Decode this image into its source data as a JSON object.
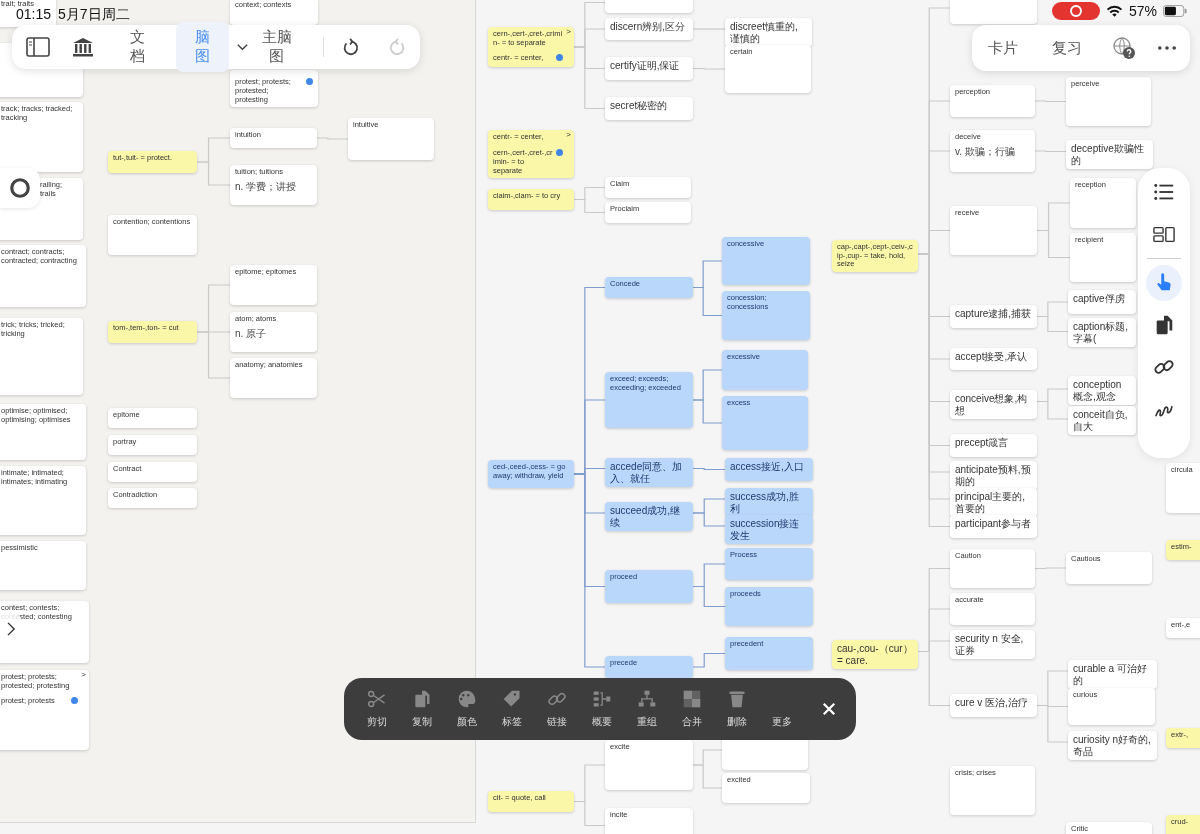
{
  "status_bar": {
    "time": "01:15",
    "date": "5月7日周二",
    "recording": true,
    "battery": "57%"
  },
  "toolbar": {
    "tabs": [
      {
        "label": "文档",
        "selected": false
      },
      {
        "label": "脑图",
        "selected": true
      }
    ],
    "map_selector": "主脑图",
    "undo": {
      "disabled": false
    },
    "redo": {
      "disabled": true
    }
  },
  "toolbar_right": {
    "tabs": [
      {
        "label": "卡片"
      },
      {
        "label": "复习"
      }
    ]
  },
  "map": {
    "nodes": [
      {
        "kind": "plain",
        "title": "trait; traits"
      },
      {
        "kind": "plain"
      },
      {
        "kind": "plain",
        "title": "track; tracks; tracked; tracking"
      },
      {
        "kind": "plain",
        "title": "railing; trails"
      },
      {
        "kind": "plain",
        "title": "contract; contracts; contracted; contracting"
      },
      {
        "kind": "plain",
        "title": "trick; tricks; tricked; tricking"
      },
      {
        "kind": "plain",
        "title": "optimise; optimised; optimising; optimises"
      },
      {
        "kind": "plain",
        "title": "intimate; intimated; intimates; intimating"
      },
      {
        "kind": "plain",
        "title": "pessimistic"
      },
      {
        "kind": "plain",
        "title": "contest; contests; contested; contesting"
      },
      {
        "kind": "plain",
        "title": "protest; protests; protested; protesting",
        "badge": ">",
        "footer": "protest; protests"
      },
      {
        "kind": "plain",
        "title": "context; contexts"
      },
      {
        "kind": "plain",
        "footer": "protest; protests; protested; protesting"
      },
      {
        "kind": "topic",
        "title": "tut-,tuit- = protect.",
        "children": [
          {
            "kind": "plain",
            "title": "intuition",
            "children": [
              {
                "kind": "plain",
                "title": "intuitive"
              }
            ]
          },
          {
            "kind": "plain",
            "title": "tuition; tuitions",
            "note": "n. 学费；讲授"
          }
        ]
      },
      {
        "kind": "plain",
        "title": "contention; contentions"
      },
      {
        "kind": "topic",
        "title": "tom-,tem-,ton- = cut",
        "children": [
          {
            "kind": "plain",
            "title": "epitome; epitomes"
          },
          {
            "kind": "plain",
            "title": "atom; atoms",
            "note": "n. 原子"
          },
          {
            "kind": "plain",
            "title": "anatomy; anatomies"
          }
        ]
      },
      {
        "kind": "plain",
        "title": "epitome"
      },
      {
        "kind": "plain",
        "title": "portray"
      },
      {
        "kind": "plain",
        "title": "Contract"
      },
      {
        "kind": "plain",
        "title": "Contradiction"
      },
      {
        "kind": "topic",
        "title": "cern-,cert-,cret-,crimin- = to separate",
        "badge": ">",
        "footer": "centr- = center,",
        "children": [
          {
            "kind": "plain"
          },
          {
            "kind": "plain",
            "title": "discern辨别,区分",
            "children": [
              {
                "kind": "plain",
                "title": "discreet慎重的,谨慎的"
              }
            ]
          },
          {
            "kind": "plain",
            "title": "certify证明,保证",
            "children": [
              {
                "kind": "plain",
                "title": "certain"
              }
            ]
          },
          {
            "kind": "plain",
            "title": "secret秘密的"
          }
        ]
      },
      {
        "kind": "topic",
        "title": "centr- = center,",
        "badge": ">",
        "footer": "cern-,cert-,cret-,crimin- = to separate"
      },
      {
        "kind": "topic",
        "title": "claim-,clam- = to cry",
        "children": [
          {
            "kind": "plain",
            "title": "Claim"
          },
          {
            "kind": "plain",
            "title": "Proclaim"
          }
        ]
      },
      {
        "kind": "blue",
        "title": "ced-,ceed-,cess- = go away; withdraw, yield",
        "children": [
          {
            "kind": "blue",
            "title": "Concede",
            "children": [
              {
                "kind": "blue",
                "title": "concessive"
              },
              {
                "kind": "blue",
                "title": "concession; concessions"
              }
            ]
          },
          {
            "kind": "blue",
            "title": "exceed; exceeds; exceeding; exceeded",
            "children": [
              {
                "kind": "blue",
                "title": "excessive"
              },
              {
                "kind": "blue",
                "title": "excess"
              }
            ]
          },
          {
            "kind": "blue",
            "title": "accede同意、加入、就任",
            "children": [
              {
                "kind": "blue",
                "title": "access接近,入口"
              }
            ]
          },
          {
            "kind": "blue",
            "title": "succeed成功,继续",
            "children": [
              {
                "kind": "blue",
                "title": "success成功,胜利"
              },
              {
                "kind": "blue",
                "title": "succession接连发生"
              }
            ]
          },
          {
            "kind": "blue",
            "title": "proceed",
            "children": [
              {
                "kind": "blue",
                "title": "Process"
              },
              {
                "kind": "blue",
                "title": "proceeds"
              }
            ]
          },
          {
            "kind": "blue",
            "title": "precede",
            "children": [
              {
                "kind": "blue",
                "title": "precedent"
              }
            ]
          }
        ]
      },
      {
        "kind": "topic",
        "title": "cit- = quote, call",
        "children": [
          {
            "kind": "plain",
            "title": "excite",
            "children": [
              {
                "kind": "plain"
              },
              {
                "kind": "plain",
                "title": "excited"
              }
            ]
          },
          {
            "kind": "plain",
            "title": "incite"
          }
        ]
      },
      {
        "kind": "topic",
        "title": "cap-,capt-,cept-,ceiv-,cip-,cup- = take, hold, seize",
        "children": [
          {
            "kind": "plain"
          },
          {
            "kind": "plain",
            "title": "perception",
            "children": [
              {
                "kind": "plain",
                "title": "perceive"
              }
            ]
          },
          {
            "kind": "plain",
            "title": "deceive",
            "note": "v. 欺骗；行骗",
            "children": [
              {
                "kind": "plain",
                "title": "deceptive欺骗性的"
              }
            ]
          },
          {
            "kind": "plain",
            "title": "receive",
            "children": [
              {
                "kind": "plain",
                "title": "reception"
              },
              {
                "kind": "plain",
                "title": "recipient"
              }
            ]
          },
          {
            "kind": "plain",
            "title": "capture逮捕,捕获",
            "children": [
              {
                "kind": "plain",
                "title": "captive俘虏"
              },
              {
                "kind": "plain",
                "title": "caption标题,字幕("
              }
            ]
          },
          {
            "kind": "plain",
            "title": "accept接受,承认"
          },
          {
            "kind": "plain",
            "title": "conceive想象,构想",
            "children": [
              {
                "kind": "plain",
                "title": "conception概念,观念"
              },
              {
                "kind": "plain",
                "title": "conceit自负,自大"
              }
            ]
          },
          {
            "kind": "plain",
            "title": "precept箴言"
          },
          {
            "kind": "plain",
            "title": "anticipate预料,预期的"
          },
          {
            "kind": "plain",
            "title": "principal主要的,首要的"
          },
          {
            "kind": "plain",
            "title": "participant参与者"
          }
        ]
      },
      {
        "kind": "topic",
        "title": "cau-,cou-（cur）= care.",
        "children": [
          {
            "kind": "plain",
            "title": "Caution",
            "children": [
              {
                "kind": "plain",
                "title": "Cautious"
              }
            ]
          },
          {
            "kind": "plain",
            "title": "accurate"
          },
          {
            "kind": "plain",
            "title": "security n 安全,证券"
          },
          {
            "kind": "plain",
            "title": "cure v 医治,治疗",
            "children": [
              {
                "kind": "plain",
                "title": "curable a 可治好的"
              },
              {
                "kind": "plain",
                "title": "curious"
              },
              {
                "kind": "plain",
                "title": "curiosity n好奇的,奇品"
              }
            ]
          }
        ]
      },
      {
        "kind": "plain",
        "title": "crisis; crises"
      },
      {
        "kind": "plain",
        "title": "Critic"
      },
      {
        "kind": "plain",
        "title": "circula"
      },
      {
        "kind": "topic",
        "title": "estim-"
      },
      {
        "kind": "plain",
        "title": "ent-,e"
      },
      {
        "kind": "topic",
        "title": "extr-,"
      },
      {
        "kind": "topic",
        "title": "crud-"
      }
    ]
  },
  "side_tools": [
    {
      "kind": "outline",
      "selected": false
    },
    {
      "kind": "layout",
      "selected": false
    },
    {
      "kind": "pointer",
      "selected": true
    },
    {
      "kind": "copy",
      "selected": false
    },
    {
      "kind": "link",
      "selected": false
    },
    {
      "kind": "draw",
      "selected": false
    }
  ],
  "action_bar": {
    "actions": [
      {
        "kind": "cut",
        "label": "剪切"
      },
      {
        "kind": "copy",
        "label": "复制"
      },
      {
        "kind": "color",
        "label": "颜色"
      },
      {
        "kind": "tag",
        "label": "标签"
      },
      {
        "kind": "link",
        "label": "链接"
      },
      {
        "kind": "summary",
        "label": "概要"
      },
      {
        "kind": "regroup",
        "label": "重组"
      },
      {
        "kind": "merge",
        "label": "合并"
      },
      {
        "kind": "delete",
        "label": "删除"
      },
      {
        "kind": "more",
        "label": "更多"
      }
    ]
  }
}
